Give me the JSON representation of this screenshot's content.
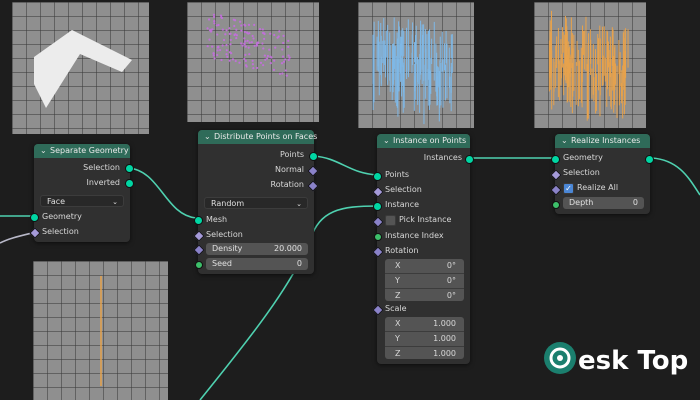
{
  "nodes": {
    "separate_geometry": {
      "title": "Separate Geometry",
      "outputs": [
        "Selection",
        "Inverted"
      ],
      "domain_value": "Face",
      "inputs": [
        "Geometry",
        "Selection"
      ]
    },
    "distribute_points": {
      "title": "Distribute Points on Faces",
      "outputs": [
        "Points",
        "Normal",
        "Rotation"
      ],
      "method_value": "Random",
      "inputs": [
        "Mesh",
        "Selection"
      ],
      "density_label": "Density",
      "density_value": "20.000",
      "seed_label": "Seed",
      "seed_value": "0"
    },
    "instance_on_points": {
      "title": "Instance on Points",
      "outputs": [
        "Instances"
      ],
      "inputs": [
        "Points",
        "Selection",
        "Instance"
      ],
      "pick_instance_label": "Pick Instance",
      "instance_index_label": "Instance Index",
      "rotation_label": "Rotation",
      "rotation": [
        {
          "axis": "X",
          "value": "0°"
        },
        {
          "axis": "Y",
          "value": "0°"
        },
        {
          "axis": "Z",
          "value": "0°"
        }
      ],
      "scale_label": "Scale",
      "scale": [
        {
          "axis": "X",
          "value": "1.000"
        },
        {
          "axis": "Y",
          "value": "1.000"
        },
        {
          "axis": "Z",
          "value": "1.000"
        }
      ]
    },
    "realize_instances": {
      "title": "Realize Instances",
      "output": "Geometry",
      "inputs": [
        "Geometry",
        "Selection"
      ],
      "realize_all_label": "Realize All",
      "realize_all_checked": true,
      "depth_label": "Depth",
      "depth_value": "0"
    }
  },
  "watermark": {
    "text": "esk Top"
  },
  "colors": {
    "wire": "#4fd1b0",
    "header": "#2f6b59",
    "preview_points": "#c070d8",
    "preview_blue": "#7fb8e6",
    "preview_orange": "#e7a24c"
  }
}
